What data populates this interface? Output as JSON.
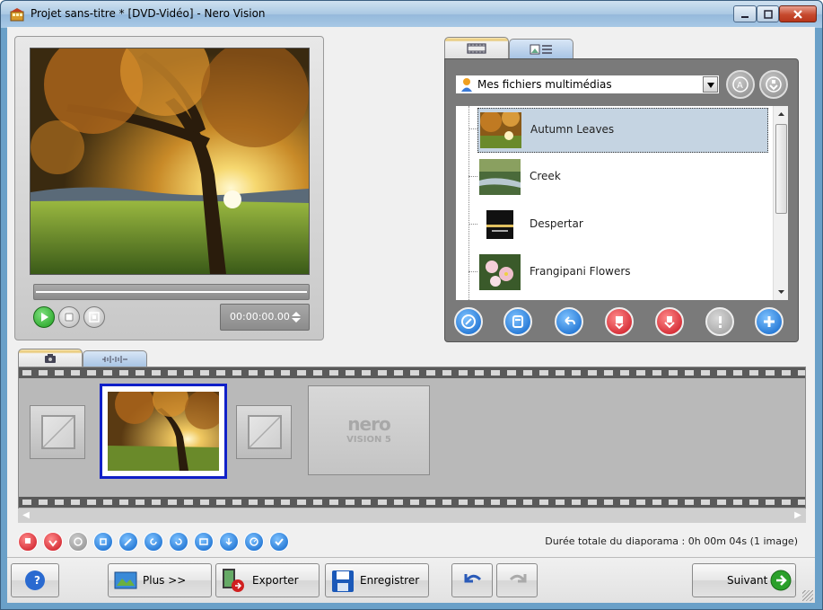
{
  "window": {
    "title": "Projet sans-titre * [DVD-Vidéo] - Nero Vision",
    "controls": [
      "minimize",
      "maximize",
      "close"
    ]
  },
  "preview": {
    "timecode": "00:00:00.00",
    "progress": 0,
    "buttons": [
      "play-icon",
      "stop-icon",
      "fullscreen-icon"
    ]
  },
  "media": {
    "tabs": [
      "film-icon",
      "photo-list-icon"
    ],
    "source_selected": "Mes fichiers multimédias",
    "items": [
      {
        "label": "Autumn Leaves",
        "selected": true
      },
      {
        "label": "Creek",
        "selected": false
      },
      {
        "label": "Despertar",
        "selected": false
      },
      {
        "label": "Frangipani Flowers",
        "selected": false
      }
    ],
    "action_icons": [
      "browse-icon",
      "import-icon",
      "back-icon",
      "red-dots-icon",
      "red-down-icon",
      "info-icon",
      "add-icon"
    ]
  },
  "storyboard": {
    "tabs": [
      "camera-icon",
      "audio-wave-icon"
    ],
    "brand_logo_main": "nero",
    "brand_logo_sub": "VISION 5",
    "duration_text": "Durée totale du diaporama : 0h 00m 04s (1 image)"
  },
  "bottom": {
    "help_label": "?",
    "more_label": "Plus >>",
    "export_label": "Exporter",
    "save_label": "Enregistrer",
    "next_label": "Suivant"
  },
  "colors": {
    "selection_border": "#1020c8",
    "list_selection": "#c5d4e2",
    "panel_gray": "#7a7a7a",
    "tab_accent": "#e8c874"
  }
}
